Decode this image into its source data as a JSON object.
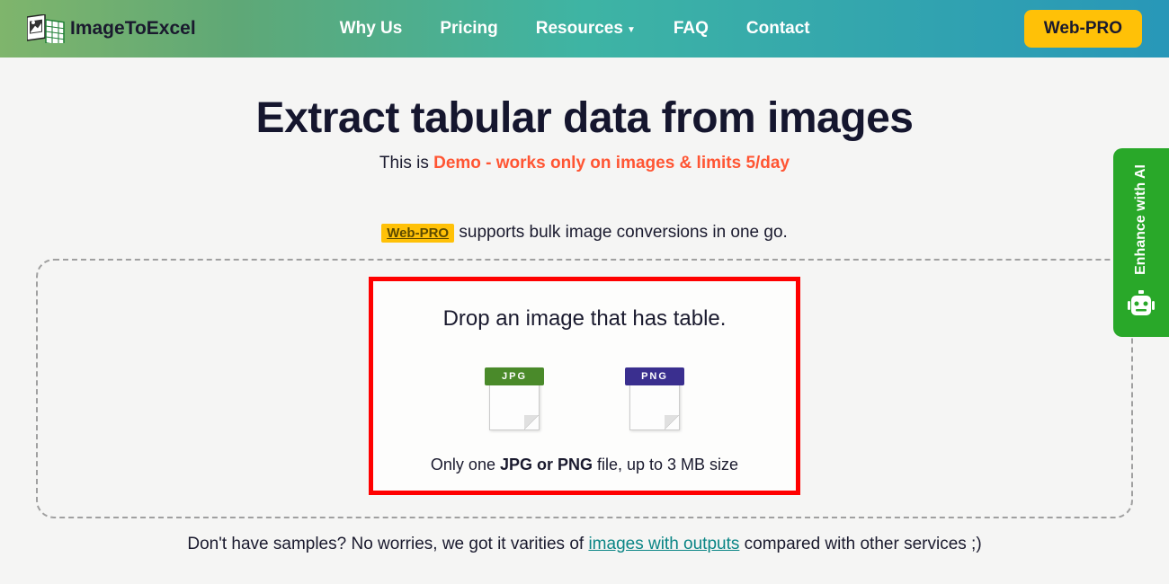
{
  "header": {
    "logo_text": "ImageToExcel",
    "nav": {
      "why_us": "Why Us",
      "pricing": "Pricing",
      "resources": "Resources",
      "faq": "FAQ",
      "contact": "Contact"
    },
    "webpro_btn": "Web-PRO"
  },
  "main": {
    "title": "Extract tabular data from images",
    "subtitle_prefix": "This is ",
    "subtitle_highlight": "Demo - works only on images & limits 5/day",
    "webpro_tag": "Web-PRO",
    "webpro_info": " supports bulk image conversions in one go.",
    "drop": {
      "title": "Drop an image that has table.",
      "jpg_label": "JPG",
      "png_label": "PNG",
      "note_prefix": "Only one ",
      "note_bold": "JPG or PNG",
      "note_suffix": " file, up to 3 MB size"
    },
    "bottom": {
      "prefix": "Don't have samples? No worries, we got it varities of ",
      "link": "images with outputs",
      "suffix": " compared with other services ;)"
    }
  },
  "sidebar": {
    "enhance_label": "Enhance with AI"
  }
}
